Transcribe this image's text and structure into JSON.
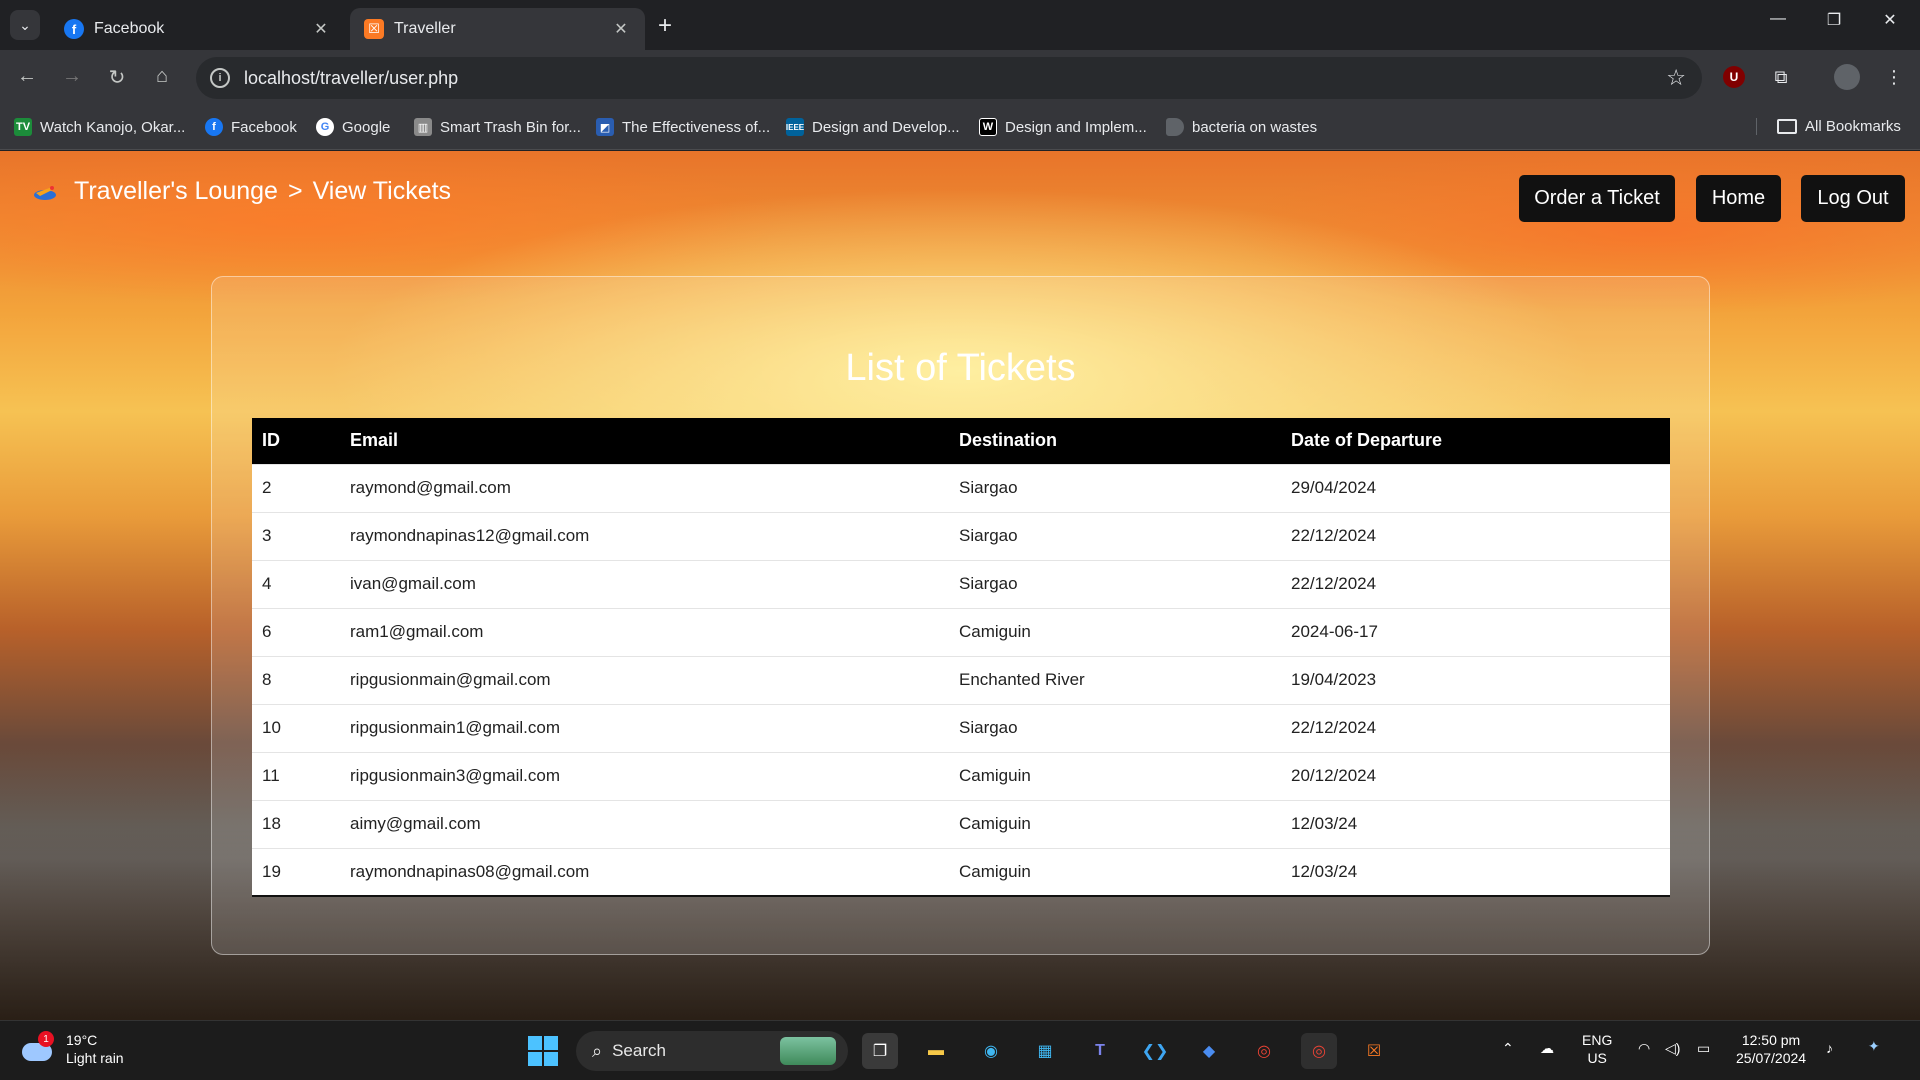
{
  "browser": {
    "tabs": [
      {
        "title": "Facebook",
        "favicon": "facebook-icon"
      },
      {
        "title": "Traveller",
        "favicon": "xampp-icon"
      }
    ],
    "url": "localhost/traveller/user.php",
    "bookmarks": [
      {
        "label": "Watch Kanojo, Okar...",
        "icon": "tv-icon"
      },
      {
        "label": "Facebook",
        "icon": "facebook-icon"
      },
      {
        "label": "Google",
        "icon": "google-icon"
      },
      {
        "label": "Smart Trash Bin for...",
        "icon": "document-icon"
      },
      {
        "label": "The Effectiveness of...",
        "icon": "document-icon"
      },
      {
        "label": "Design and Develop...",
        "icon": "ieee-icon"
      },
      {
        "label": "Design and Implem...",
        "icon": "wikipedia-icon"
      },
      {
        "label": "bacteria on wastes",
        "icon": "page-icon"
      }
    ],
    "all_bookmarks": "All Bookmarks"
  },
  "page": {
    "brand": "Traveller's Lounge",
    "separator": ">",
    "section": "View Tickets",
    "nav": {
      "order": "Order a Ticket",
      "home": "Home",
      "logout": "Log Out"
    },
    "heading": "List of Tickets",
    "table": {
      "headers": [
        "ID",
        "Email",
        "Destination",
        "Date of Departure"
      ],
      "rows": [
        [
          "2",
          "raymond@gmail.com",
          "Siargao",
          "29/04/2024"
        ],
        [
          "3",
          "raymondnapinas12@gmail.com",
          "Siargao",
          "22/12/2024"
        ],
        [
          "4",
          "ivan@gmail.com",
          "Siargao",
          "22/12/2024"
        ],
        [
          "6",
          "ram1@gmail.com",
          "Camiguin",
          "2024-06-17"
        ],
        [
          "8",
          "ripgusionmain@gmail.com",
          "Enchanted River",
          "19/04/2023"
        ],
        [
          "10",
          "ripgusionmain1@gmail.com",
          "Siargao",
          "22/12/2024"
        ],
        [
          "11",
          "ripgusionmain3@gmail.com",
          "Camiguin",
          "20/12/2024"
        ],
        [
          "18",
          "aimy@gmail.com",
          "Camiguin",
          "12/03/24"
        ],
        [
          "19",
          "raymondnapinas08@gmail.com",
          "Camiguin",
          "12/03/24"
        ]
      ]
    }
  },
  "taskbar": {
    "weather": {
      "temp": "19°C",
      "condition": "Light rain",
      "badge": "1"
    },
    "search_label": "Search",
    "lang": {
      "line1": "ENG",
      "line2": "US"
    },
    "time": "12:50 pm",
    "date": "25/07/2024"
  },
  "colors": {
    "chrome_bg": "#202124",
    "toolbar_bg": "#35363a",
    "table_header": "#000000",
    "nav_button": "#111111"
  }
}
